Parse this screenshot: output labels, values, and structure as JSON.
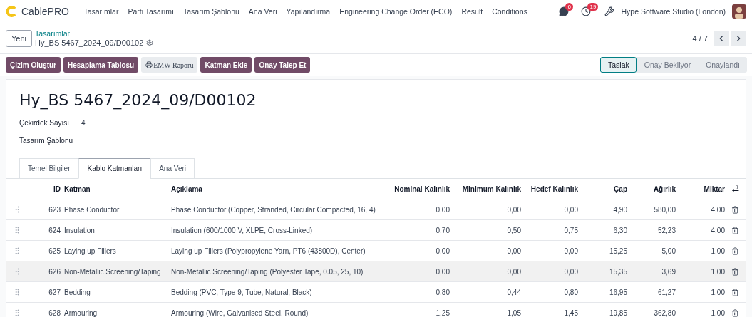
{
  "app": {
    "name": "CablePRO"
  },
  "menu": [
    "Tasarımlar",
    "Parti Tasarımı",
    "Tasarım Şablonu",
    "Ana Veri",
    "Yapılandırma",
    "Engineering Change Order (ECO)",
    "Result",
    "Conditions"
  ],
  "systray": {
    "messages_count": "6",
    "activities_count": "19",
    "company": "Hype Software Studio (London)"
  },
  "breadcrumb": {
    "new_button": "Yeni",
    "parent": "Tasarımlar",
    "current": "Hy_BS 5467_2024_09/D00102"
  },
  "pager": {
    "value": "4 / 7"
  },
  "actions": [
    {
      "label": "Çizim Oluştur",
      "kind": "primary"
    },
    {
      "label": "Hesaplama Tablosu",
      "kind": "primary"
    },
    {
      "label": "EMW Raporu",
      "kind": "report"
    },
    {
      "label": "Katman Ekle",
      "kind": "primary"
    },
    {
      "label": "Onay Talep Et",
      "kind": "primary"
    }
  ],
  "stages": [
    {
      "label": "Taslak",
      "selected": true
    },
    {
      "label": "Onay Bekliyor",
      "selected": false
    },
    {
      "label": "Onaylandı",
      "selected": false
    }
  ],
  "record": {
    "title": "Hy_BS 5467_2024_09/D00102",
    "fields": [
      {
        "label": "Çekirdek Sayısı",
        "value": "4"
      },
      {
        "label": "Tasarım Şablonu"
      }
    ]
  },
  "tabs": [
    {
      "label": "Temel Bilgiler",
      "selected": false
    },
    {
      "label": "Kablo Katmanları",
      "selected": true
    },
    {
      "label": "Ana Veri",
      "selected": false
    }
  ],
  "table": {
    "columns": [
      "ID",
      "Katman",
      "Açıklama",
      "Nominal Kalınlık",
      "Minimum Kalınlık",
      "Hedef Kalınlık",
      "Çap",
      "Ağırlık",
      "Miktar"
    ],
    "rows": [
      {
        "cells": [
          "623",
          "Phase Conductor",
          "Phase Conductor (Copper, Stranded, Circular Compacted, 16, 4)",
          "0,00",
          "0,00",
          "0,00",
          "4,90",
          "580,00",
          "4,00"
        ],
        "highlighted": false
      },
      {
        "cells": [
          "624",
          "Insulation",
          "Insulation (600/1000 V, XLPE, Cross-Linked)",
          "0,70",
          "0,50",
          "0,75",
          "6,30",
          "52,23",
          "4,00"
        ],
        "highlighted": false
      },
      {
        "cells": [
          "625",
          "Laying up Fillers",
          "Laying up Fillers (Polypropylene Yarn, PT6 (43800D), Center)",
          "0,00",
          "0,00",
          "0,00",
          "15,25",
          "5,00",
          "1,00"
        ],
        "highlighted": false
      },
      {
        "cells": [
          "626",
          "Non-Metallic Screening/Taping",
          "Non-Metallic Screening/Taping (Polyester Tape, 0.05, 25, 10)",
          "0,00",
          "0,00",
          "0,00",
          "15,35",
          "3,69",
          "1,00"
        ],
        "highlighted": true
      },
      {
        "cells": [
          "627",
          "Bedding",
          "Bedding (PVC, Type 9, Tube, Natural, Black)",
          "0,80",
          "0,44",
          "0,80",
          "16,95",
          "61,27",
          "1,00"
        ],
        "highlighted": false
      },
      {
        "cells": [
          "628",
          "Armouring",
          "Armouring (Wire, Galvanised Steel, Round)",
          "1,25",
          "1,05",
          "1,45",
          "19,85",
          "362,80",
          "1,00"
        ],
        "highlighted": false
      }
    ]
  }
}
